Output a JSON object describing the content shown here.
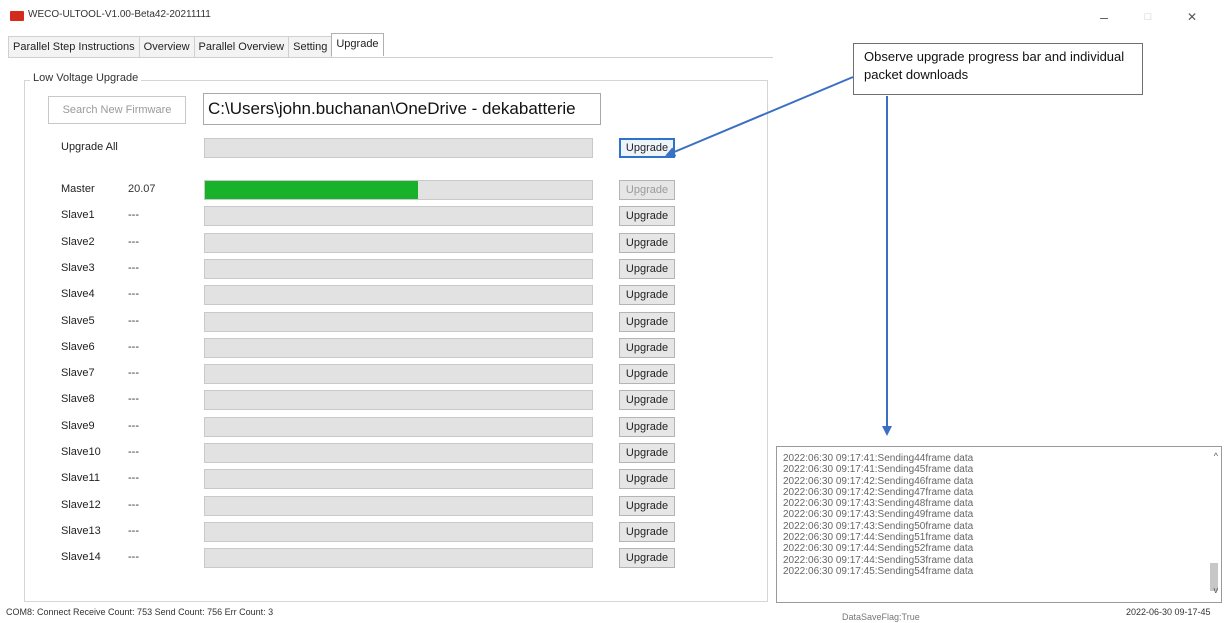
{
  "window": {
    "title": "WECO-ULTOOL-V1.00-Beta42-20211111",
    "minimize_glyph": "–",
    "maximize_glyph": "□",
    "close_glyph": "✕"
  },
  "tabs": [
    {
      "label": "Parallel Step Instructions"
    },
    {
      "label": "Overview"
    },
    {
      "label": "Parallel Overview"
    },
    {
      "label": "Setting"
    },
    {
      "label": "Upgrade",
      "active": true
    }
  ],
  "upgrade": {
    "group_label": "Low Voltage Upgrade",
    "search_button": "Search New Firmware",
    "path_value": "C:\\Users\\john.buchanan\\OneDrive - dekabatterie",
    "button_label": "Upgrade",
    "rows": [
      {
        "label": "Upgrade All",
        "version": "",
        "progress": 0,
        "button_state": "focused"
      },
      {
        "label": "Master",
        "version": "20.07",
        "progress": 0.55,
        "button_state": "disabled"
      },
      {
        "label": "Slave1",
        "version": "---",
        "progress": 0,
        "button_state": "normal"
      },
      {
        "label": "Slave2",
        "version": "---",
        "progress": 0,
        "button_state": "normal"
      },
      {
        "label": "Slave3",
        "version": "---",
        "progress": 0,
        "button_state": "normal"
      },
      {
        "label": "Slave4",
        "version": "---",
        "progress": 0,
        "button_state": "normal"
      },
      {
        "label": "Slave5",
        "version": "---",
        "progress": 0,
        "button_state": "normal"
      },
      {
        "label": "Slave6",
        "version": "---",
        "progress": 0,
        "button_state": "normal"
      },
      {
        "label": "Slave7",
        "version": "---",
        "progress": 0,
        "button_state": "normal"
      },
      {
        "label": "Slave8",
        "version": "---",
        "progress": 0,
        "button_state": "normal"
      },
      {
        "label": "Slave9",
        "version": "---",
        "progress": 0,
        "button_state": "normal"
      },
      {
        "label": "Slave10",
        "version": "---",
        "progress": 0,
        "button_state": "normal"
      },
      {
        "label": "Slave11",
        "version": "---",
        "progress": 0,
        "button_state": "normal"
      },
      {
        "label": "Slave12",
        "version": "---",
        "progress": 0,
        "button_state": "normal"
      },
      {
        "label": "Slave13",
        "version": "---",
        "progress": 0,
        "button_state": "normal"
      },
      {
        "label": "Slave14",
        "version": "---",
        "progress": 0,
        "button_state": "normal"
      }
    ]
  },
  "callout": {
    "text": "Observe upgrade progress bar and individual packet downloads"
  },
  "log": {
    "lines": [
      "2022:06:30 09:17:41:Sending44frame data",
      "2022:06:30 09:17:41:Sending45frame data",
      "2022:06:30 09:17:42:Sending46frame data",
      "2022:06:30 09:17:42:Sending47frame data",
      "2022:06:30 09:17:43:Sending48frame data",
      "2022:06:30 09:17:43:Sending49frame data",
      "2022:06:30 09:17:43:Sending50frame data",
      "2022:06:30 09:17:44:Sending51frame data",
      "2022:06:30 09:17:44:Sending52frame data",
      "2022:06:30 09:17:44:Sending53frame data",
      "2022:06:30 09:17:45:Sending54frame data"
    ],
    "scroll_up_glyph": "^",
    "scroll_down_glyph": "v"
  },
  "status": {
    "left": "COM8: Connect  Receive Count: 753  Send Count: 756  Err Count: 3",
    "center": "DataSaveFlag:True",
    "right": "2022-06-30 09-17-45"
  },
  "colors": {
    "progress_fill": "#17b12a",
    "app_icon": "#d42b1e",
    "arrow": "#3b6fc4"
  }
}
